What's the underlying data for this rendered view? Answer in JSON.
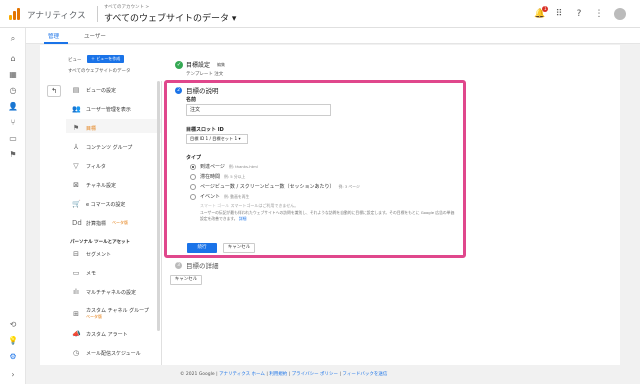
{
  "colors": {
    "accent": "#1a73e8",
    "highlight": "#e0478c",
    "active_menu": "#e37400",
    "success": "#34a853"
  },
  "header": {
    "app_name": "アナリティクス",
    "breadcrumb": "すべてのアカウント >",
    "view_title": "すべてのウェブサイトのデータ ▾",
    "notification_count": "1",
    "icons": [
      "notification-icon",
      "apps-icon",
      "help-icon",
      "more-icon",
      "avatar"
    ]
  },
  "tabs": [
    {
      "label": "管理"
    },
    {
      "label": "ユーザー"
    }
  ],
  "view_panel": {
    "label": "ビュー",
    "create_button": "＋ ビューを作成",
    "view_name": "すべてのウェブサイトのデータ"
  },
  "menu": {
    "items": [
      {
        "label": "ビューの設定",
        "icon": "document-icon"
      },
      {
        "label": "ユーザー管理を表示",
        "icon": "users-icon"
      },
      {
        "label": "目標",
        "icon": "flag-icon"
      },
      {
        "label": "コンテンツ グループ",
        "icon": "group-icon"
      },
      {
        "label": "フィルタ",
        "icon": "filter-icon"
      },
      {
        "label": "チャネル設定",
        "icon": "channel-icon"
      },
      {
        "label": "e コマースの設定",
        "icon": "cart-icon"
      },
      {
        "label": "計算指標",
        "sub": "ベータ版",
        "icon": "calc-icon"
      }
    ],
    "section": "パーソナル ツールとアセット",
    "items2": [
      {
        "label": "セグメント",
        "icon": "segment-icon"
      },
      {
        "label": "メモ",
        "icon": "memo-icon"
      },
      {
        "label": "マルチチャネルの設定",
        "icon": "bar-chart-icon"
      },
      {
        "label": "カスタム チャネル グループ",
        "sub": "ベータ版",
        "icon": "custom-channel-icon"
      },
      {
        "label": "カスタム アラート",
        "icon": "alert-icon"
      },
      {
        "label": "メール配信スケジュール",
        "icon": "clock-icon"
      }
    ]
  },
  "goal": {
    "step1_title": "目標設定",
    "step1_edit": "編集",
    "template_line": "テンプレート 注文",
    "step2_num": "2",
    "step2_title": "目標の説明",
    "name_label": "名前",
    "name_value": "注文",
    "slot_label": "目標スロット ID",
    "slot_value": "目標 ID 1 / 目標セット 1 ▾",
    "type_label": "タイプ",
    "types": [
      {
        "label": "到達ページ",
        "example": "例: thanks.html",
        "selected": true
      },
      {
        "label": "滞在時間",
        "example": "例: 5 分以上",
        "selected": false
      },
      {
        "label": "ページビュー数 / スクリーンビュー数（セッションあたり）",
        "example": "例: 3 ページ",
        "selected": false
      },
      {
        "label": "イベント",
        "example": "例: 動画を再生",
        "selected": false
      }
    ],
    "smart_goal": "スマート ゴール",
    "smart_note": "スマートゴールはご利用できません。",
    "description": "ユーザーの伝記が最も伴われたウェブサイトへの訪問を識別し、それような訪問を自動的に目標に設定します。その目標をもとに Google 広告の単価設定を改善できます。",
    "description_link": "詳細",
    "continue_button": "続行",
    "cancel_button": "キャンセル",
    "step3_num": "3",
    "step3_title": "目標の詳細",
    "cancel_button2": "キャンセル"
  },
  "footer": {
    "copyright": "© 2021 Google",
    "links": [
      "アナリティクス ホーム",
      "利用規約",
      "プライバシー ポリシー",
      "フィードバックを送信"
    ]
  }
}
